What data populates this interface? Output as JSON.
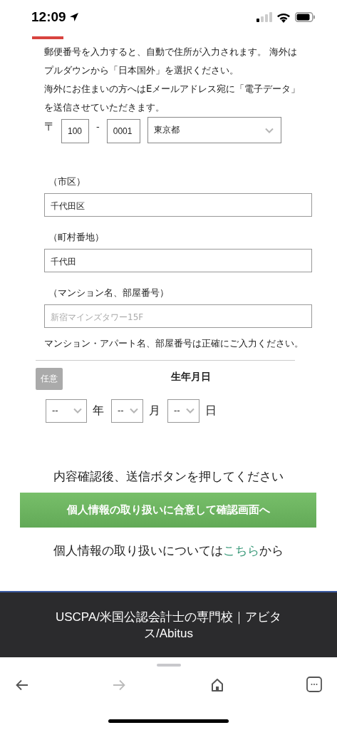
{
  "status_bar": {
    "time": "12:09"
  },
  "intro": [
    "郵便番号を入力すると、自動で住所が入力されます。 海外はプルダウンから「日本国外」を選択ください。",
    "海外にお住まいの方へはEメールアドレス宛に「電子データ」を送信させていただきます。"
  ],
  "postal": {
    "mark": "〒",
    "first": "100",
    "separator": "-",
    "second": "0001",
    "prefecture": "東京都"
  },
  "address_fields": [
    {
      "label": "（市区）",
      "value": "千代田区"
    },
    {
      "label": "（町村番地）",
      "value": "千代田"
    },
    {
      "label": "（マンション名、部屋番号）",
      "placeholder": "新宿マインズタワー15F"
    }
  ],
  "address_note": "マンション・アパート名、部屋番号は正確にご入力ください。",
  "birthday": {
    "badge": "任意",
    "title": "生年月日",
    "selects": [
      {
        "value": "--",
        "unit": "年"
      },
      {
        "value": "--",
        "unit": "月"
      },
      {
        "value": "--",
        "unit": "日"
      }
    ]
  },
  "submit_hint": "内容確認後、送信ボタンを押してください",
  "submit_button": "個人情報の取り扱いに合意して確認画面へ",
  "privacy": {
    "text": "個人情報の取り扱いについては",
    "link": "こちら",
    "suffix": "から"
  },
  "footer": {
    "title": "USCPA/米国公認会計士の専門校｜アビタス/Abitus"
  },
  "browser_bar": {
    "back_disabled": false,
    "forward_disabled": true
  }
}
